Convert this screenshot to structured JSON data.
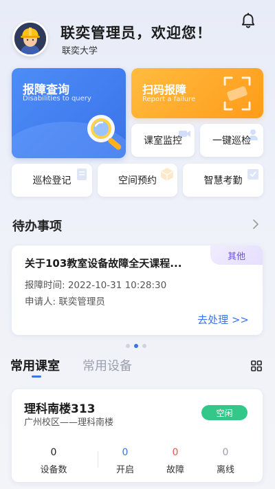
{
  "header": {
    "greeting": "联奕管理员，欢迎您！",
    "school": "联奕大学"
  },
  "tiles": {
    "report_query": {
      "title": "报障查询",
      "subtitle": "Disabilities to query"
    },
    "scan_report": {
      "title": "扫码报障",
      "subtitle": "Report a failure"
    },
    "classroom_monitor": "课室监控",
    "one_click_patrol": "一键巡检",
    "patrol_register": "巡检登记",
    "space_booking": "空间预约",
    "smart_attendance": "智慧考勤"
  },
  "pending": {
    "section_title": "待办事项",
    "card": {
      "title": "关于103教室设备故障全天课程...",
      "tag": "其他",
      "report_time": "报障时间: 2022-10-31 10:28:30",
      "applicant": "申请人: 联奕管理员",
      "action": "去处理 >>"
    },
    "carousel": {
      "count": 3,
      "active": 1
    }
  },
  "tabs": [
    {
      "label": "常用课室",
      "active": true
    },
    {
      "label": "常用设备",
      "active": false
    }
  ],
  "room": {
    "name": "理科南楼313",
    "location": "广州校区——理科南楼",
    "status": "空闲",
    "stats": [
      {
        "value": "0",
        "label": "设备数",
        "color": "#222222"
      },
      {
        "value": "0",
        "label": "开启",
        "color": "#3a73ea"
      },
      {
        "value": "0",
        "label": "故障",
        "color": "#e8554e"
      },
      {
        "value": "0",
        "label": "离线",
        "color": "#9aa0ad"
      }
    ]
  },
  "colors": {
    "primary": "#3a73ea",
    "orange": "#ff9b1a",
    "success": "#34c78a",
    "tag_purple": "#6a55d8"
  }
}
